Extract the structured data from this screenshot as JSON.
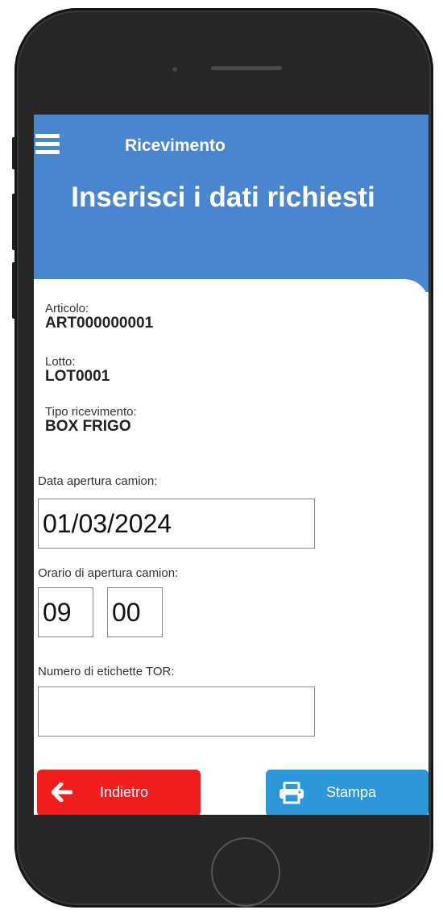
{
  "header": {
    "app_title": "Ricevimento",
    "page_heading": "Inserisci i dati richiesti",
    "menu_icon": "hamburger-menu-icon"
  },
  "info": {
    "articolo": {
      "label": "Articolo:",
      "value": "ART000000001"
    },
    "lotto": {
      "label": "Lotto:",
      "value": "LOT0001"
    },
    "tipo": {
      "label": "Tipo ricevimento:",
      "value": "BOX FRIGO"
    }
  },
  "form": {
    "data_apertura": {
      "label": "Data apertura camion:",
      "value": "01/03/2024"
    },
    "orario_apertura": {
      "label": "Orario di apertura camion:",
      "hours": "09",
      "minutes": "00"
    },
    "numero_etichette": {
      "label": "Numero di etichette TOR:",
      "value": ""
    }
  },
  "actions": {
    "back": {
      "label": "Indietro",
      "icon": "arrow-left-icon",
      "color": "#f41d1d"
    },
    "print": {
      "label": "Stampa",
      "icon": "printer-icon",
      "color": "#2b98dc"
    }
  },
  "colors": {
    "header": "#4a86cf",
    "text": "#222222"
  }
}
